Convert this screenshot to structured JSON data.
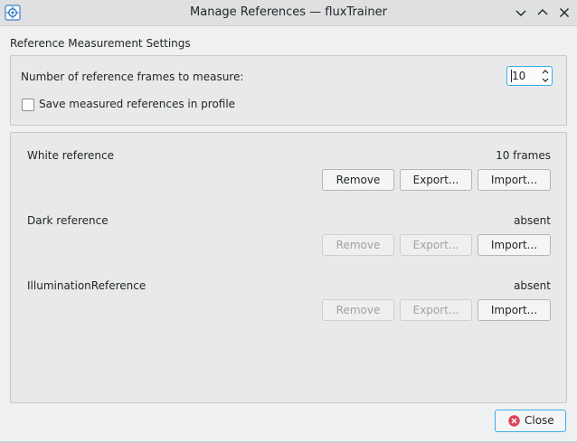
{
  "window": {
    "title": "Manage References — fluxTrainer",
    "app_icon": "gear-chip-icon",
    "controls": [
      "chevron-down-icon",
      "chevron-up-icon",
      "close-x-icon"
    ]
  },
  "settings": {
    "section_title": "Reference Measurement Settings",
    "frames_label": "Number of reference frames to measure:",
    "frames_value": "10",
    "save_label": "Save measured references in profile",
    "save_checked": false
  },
  "references": [
    {
      "name": "White reference",
      "status": "10 frames",
      "remove": "Remove",
      "export": "Export...",
      "import": "Import...",
      "remove_enabled": true,
      "export_enabled": true
    },
    {
      "name": "Dark reference",
      "status": "absent",
      "remove": "Remove",
      "export": "Export...",
      "import": "Import...",
      "remove_enabled": false,
      "export_enabled": false
    },
    {
      "name": "IlluminationReference",
      "status": "absent",
      "remove": "Remove",
      "export": "Export...",
      "import": "Import...",
      "remove_enabled": false,
      "export_enabled": false
    }
  ],
  "footer": {
    "close_label": "Close",
    "close_icon": "close-circle-icon"
  },
  "colors": {
    "accent": "#3daee9",
    "close_icon": "#da4453",
    "disabled_text": "#a0a2a4"
  }
}
